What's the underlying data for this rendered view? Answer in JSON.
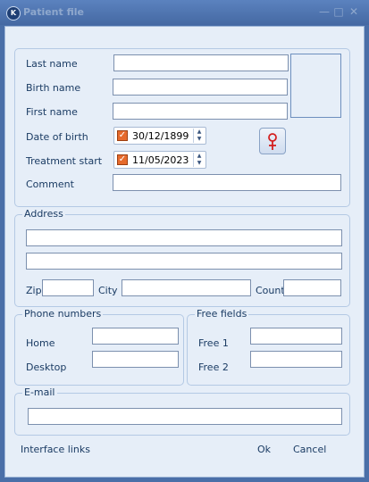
{
  "window": {
    "title": "Patient file",
    "icon": "app-logo-icon"
  },
  "identity": {
    "last_name_label": "Last name",
    "birth_name_label": "Birth name",
    "first_name_label": "First name",
    "dob_label": "Date of birth",
    "dob_value": "30/12/1899",
    "treatment_start_label": "Treatment start",
    "treatment_start_value": "11/05/2023",
    "comment_label": "Comment"
  },
  "address": {
    "legend": "Address",
    "zip_label": "Zip",
    "city_label": "City",
    "country_label": "Count"
  },
  "phones": {
    "legend": "Phone numbers",
    "home_label": "Home",
    "desktop_label": "Desktop"
  },
  "free_fields": {
    "legend": "Free fields",
    "free1_label": "Free 1",
    "free2_label": "Free 2"
  },
  "email": {
    "legend": "E-mail"
  },
  "footer": {
    "interface_links": "Interface links",
    "ok": "Ok",
    "cancel": "Cancel"
  },
  "colors": {
    "accent": "#e66a2c",
    "text": "#1a3b63",
    "panel": "#e6eef8",
    "frame": "#4a6fa8",
    "female_symbol": "#d42020"
  }
}
